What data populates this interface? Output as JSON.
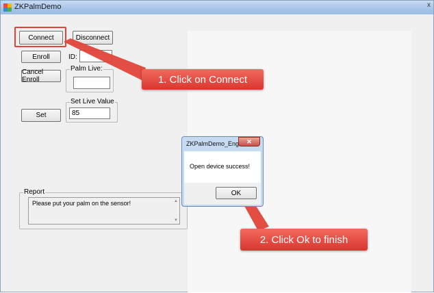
{
  "window": {
    "title": "ZKPalmDemo",
    "close_glyph": "x"
  },
  "buttons": {
    "connect": "Connect",
    "disconnect": "Disconnect",
    "enroll": "Enroll",
    "cancel_enroll": "Cancel Enroll",
    "set": "Set"
  },
  "fields": {
    "id_label": "ID:",
    "id_value": "",
    "palm_live_label": "Palm Live:",
    "palm_live_value": "",
    "set_live_value_label": "Set Live Value",
    "set_live_value": "85"
  },
  "report": {
    "label": "Report",
    "text": "Please put your palm on the sensor!"
  },
  "dialog": {
    "title": "ZKPalmDemo_English",
    "close_glyph": "✕",
    "message": "Open device success!",
    "ok_label": "OK"
  },
  "annotations": {
    "step1": "1. Click on Connect",
    "step2": "2. Click Ok to finish",
    "color": "#e0433a"
  },
  "icons": [
    "app-icon",
    "close-icon",
    "scroll-up-icon",
    "scroll-down-icon"
  ]
}
